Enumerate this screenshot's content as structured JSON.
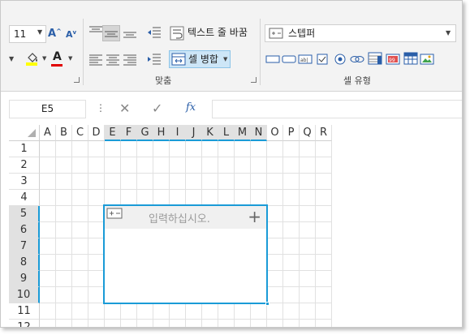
{
  "ribbon": {
    "font_size": "11",
    "wrap_text_label": "텍스트 줄 바꿈",
    "merge_cells_label": "셀 병합",
    "alignment_group_label": "맞춤",
    "cell_style_value": "스텝퍼",
    "cell_type_group_label": "셀 유형"
  },
  "formula_bar": {
    "name_box": "E5",
    "formula_value": ""
  },
  "sheet": {
    "columns": [
      "A",
      "B",
      "C",
      "D",
      "E",
      "F",
      "G",
      "H",
      "I",
      "J",
      "K",
      "L",
      "M",
      "N",
      "O",
      "P",
      "Q",
      "R"
    ],
    "rows": [
      "1",
      "2",
      "3",
      "4",
      "5",
      "6",
      "7",
      "8",
      "9",
      "10",
      "11",
      "12"
    ],
    "selected_columns": [
      "E",
      "F",
      "G",
      "H",
      "I",
      "J",
      "K",
      "L",
      "M",
      "N"
    ],
    "selected_rows": [
      "5",
      "6",
      "7",
      "8",
      "9",
      "10"
    ]
  },
  "stepper_cell": {
    "placeholder": "입력하십시오.",
    "plus_label": "+"
  },
  "colors": {
    "accent": "#1a9bd7",
    "selection_header": "#e1e1e1",
    "font_color": "#e00000",
    "highlight_color": "#ffff00"
  }
}
